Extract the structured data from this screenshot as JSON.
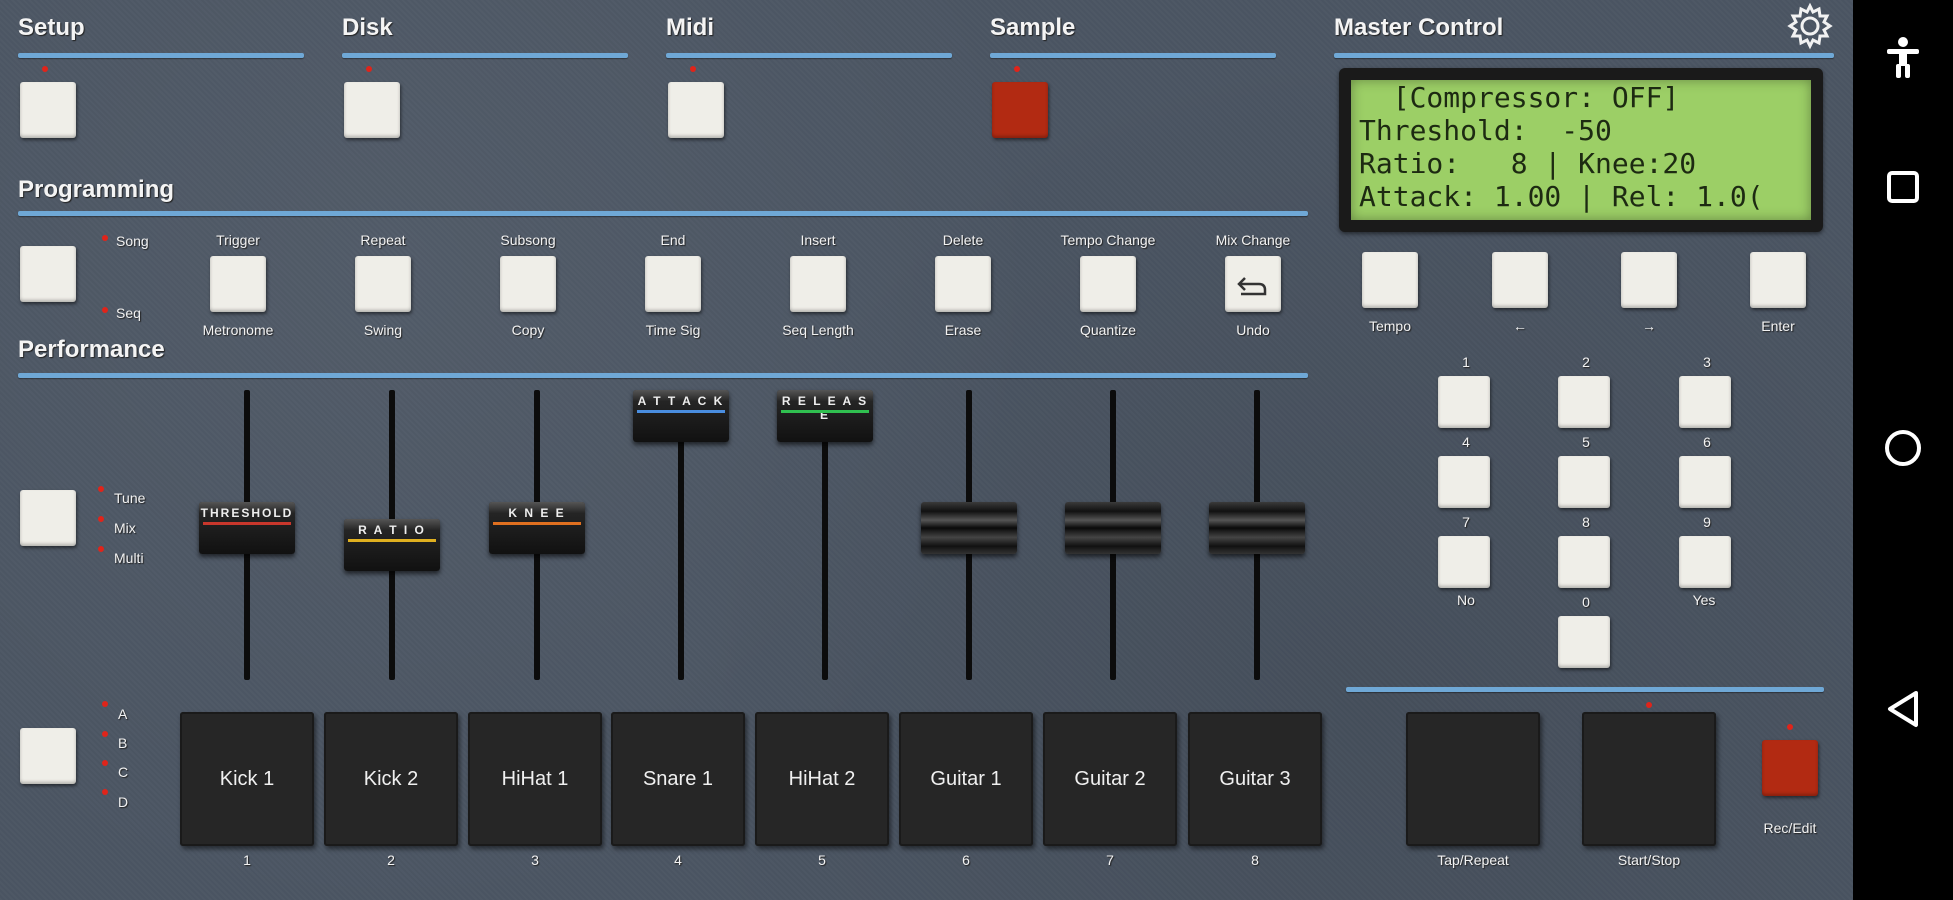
{
  "sections": {
    "setup": "Setup",
    "disk": "Disk",
    "midi": "Midi",
    "sample": "Sample",
    "master_control": "Master Control",
    "programming": "Programming",
    "performance": "Performance"
  },
  "lcd": {
    "line1": "  [Compressor: OFF]",
    "line2": "Threshold:  -50",
    "line3": "Ratio:   8 | Knee:20",
    "line4": "Attack: 1.00 | Rel: 1.0("
  },
  "programming": {
    "mode_labels": [
      "Song",
      "Seq"
    ],
    "buttons": [
      {
        "top": "Trigger",
        "bottom": "Metronome"
      },
      {
        "top": "Repeat",
        "bottom": "Swing"
      },
      {
        "top": "Subsong",
        "bottom": "Copy"
      },
      {
        "top": "End",
        "bottom": "Time Sig"
      },
      {
        "top": "Insert",
        "bottom": "Seq Length"
      },
      {
        "top": "Delete",
        "bottom": "Erase"
      },
      {
        "top": "Tempo Change",
        "bottom": "Quantize"
      },
      {
        "top": "Mix Change",
        "bottom": "Undo"
      }
    ]
  },
  "master": {
    "nav_buttons": [
      "Tempo",
      "←",
      "→",
      "Enter"
    ],
    "keypad": [
      "1",
      "2",
      "3",
      "4",
      "5",
      "6",
      "7",
      "8",
      "9",
      "0"
    ],
    "no_label": "No",
    "yes_label": "Yes"
  },
  "performance": {
    "mode_labels": [
      "Tune",
      "Mix",
      "Multi"
    ],
    "fader_caps": [
      {
        "label": "THRESHOLD",
        "color": "#c8372c",
        "level": 0.53
      },
      {
        "label": "R A T I O",
        "color": "#e0b020",
        "level": 0.46
      },
      {
        "label": "K N E E",
        "color": "#e07020",
        "level": 0.53
      },
      {
        "label": "A T T A C K",
        "color": "#4a8ee0",
        "level": 1.0
      },
      {
        "label": "R E L E A S E",
        "color": "#30c050",
        "level": 1.0
      }
    ],
    "plain_faders": [
      {
        "level": 0.53
      },
      {
        "level": 0.53
      },
      {
        "level": 0.53
      }
    ],
    "bank_labels": [
      "A",
      "B",
      "C",
      "D"
    ],
    "pads": [
      "Kick 1",
      "Kick 2",
      "HiHat 1",
      "Snare 1",
      "HiHat 2",
      "Guitar 1",
      "Guitar 2",
      "Guitar 3"
    ],
    "pad_numbers": [
      "1",
      "2",
      "3",
      "4",
      "5",
      "6",
      "7",
      "8"
    ]
  },
  "transport": {
    "tap_repeat": "Tap/Repeat",
    "start_stop": "Start/Stop",
    "rec_edit": "Rec/Edit"
  },
  "colors": {
    "accent_rule": "#6fa8d6",
    "record_red": "#b22a12",
    "lcd_green": "#9ccf66"
  },
  "icons": {
    "settings": "gear-icon",
    "undo": "undo-icon"
  },
  "system_nav": [
    "accessibility-icon",
    "square-icon",
    "circle-icon",
    "back-triangle-icon"
  ]
}
